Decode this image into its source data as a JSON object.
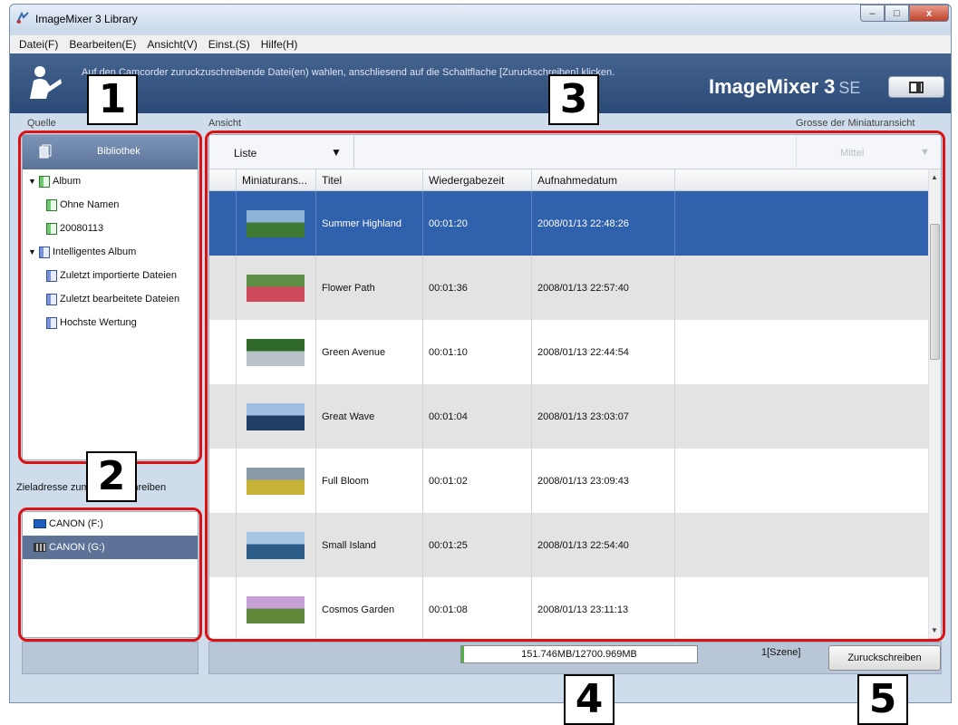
{
  "window": {
    "title": "ImageMixer 3 Library",
    "controls": [
      "–",
      "□",
      "x"
    ]
  },
  "menu": [
    "Datei(F)",
    "Bearbeiten(E)",
    "Ansicht(V)",
    "Einst.(S)",
    "Hilfe(H)"
  ],
  "banner": {
    "instruction": "Auf den Camcorder zuruckzuschreibende Datei(en) wahlen, anschliesend auf die Schaltflache [Zuruckschreiben] klicken.",
    "logo": "ImageMixer 3",
    "logo_suffix": "SE"
  },
  "labels": {
    "quelle": "Quelle",
    "ansicht": "Ansicht",
    "groesse": "Grosse der Miniaturansicht",
    "zieladresse": "Zieladresse zum Zuruckschreiben"
  },
  "library": {
    "header": "Bibliothek",
    "tree": [
      {
        "label": "Album",
        "level": 0,
        "expanded": true,
        "icon": "album-icon"
      },
      {
        "label": "Ohne Namen",
        "level": 1,
        "icon": "album-icon"
      },
      {
        "label": "20080113",
        "level": 1,
        "icon": "album-icon"
      },
      {
        "label": "Intelligentes Album",
        "level": 0,
        "expanded": true,
        "icon": "smart-album-icon"
      },
      {
        "label": "Zuletzt importierte Dateien",
        "level": 1,
        "icon": "smart-album-icon"
      },
      {
        "label": "Zuletzt bearbeitete Dateien",
        "level": 1,
        "icon": "smart-album-icon"
      },
      {
        "label": "Hochste Wertung",
        "level": 1,
        "icon": "smart-album-icon"
      }
    ]
  },
  "destinations": [
    {
      "label": "CANON (F:)",
      "icon": "sd-card-icon",
      "selected": false
    },
    {
      "label": "CANON (G:)",
      "icon": "tape-icon",
      "selected": true
    }
  ],
  "toolbar": {
    "view_mode": "Liste",
    "thumb_size": "Mittel"
  },
  "columns": [
    "Miniaturans...",
    "Titel",
    "Wiedergabezeit",
    "Aufnahmedatum"
  ],
  "rows": [
    {
      "title": "Summer Highland",
      "duration": "00:01:20",
      "date": "2008/01/13 22:48:26",
      "selected": true,
      "thumb": [
        "#8fb4d8",
        "#3f7a34"
      ]
    },
    {
      "title": "Flower Path",
      "duration": "00:01:36",
      "date": "2008/01/13 22:57:40",
      "selected": false,
      "thumb": [
        "#5f8e46",
        "#d0485c"
      ]
    },
    {
      "title": "Green Avenue",
      "duration": "00:01:10",
      "date": "2008/01/13 22:44:54",
      "selected": false,
      "thumb": [
        "#2f6a2a",
        "#b8c2c8"
      ]
    },
    {
      "title": "Great Wave",
      "duration": "00:01:04",
      "date": "2008/01/13 23:03:07",
      "selected": false,
      "thumb": [
        "#9fc0e0",
        "#1e3e66"
      ]
    },
    {
      "title": "Full Bloom",
      "duration": "00:01:02",
      "date": "2008/01/13 23:09:43",
      "selected": false,
      "thumb": [
        "#8a9aa8",
        "#c8b238"
      ]
    },
    {
      "title": "Small Island",
      "duration": "00:01:25",
      "date": "2008/01/13 22:54:40",
      "selected": false,
      "thumb": [
        "#a6c6e6",
        "#2f5d8a"
      ]
    },
    {
      "title": "Cosmos Garden",
      "duration": "00:01:08",
      "date": "2008/01/13 23:11:13",
      "selected": false,
      "thumb": [
        "#c6a0d6",
        "#5f8a3c"
      ]
    }
  ],
  "status": {
    "capacity": "151.746MB/12700.969MB",
    "capacity_fraction": 0.012,
    "scene": "1[Szene]",
    "write_back_button": "Zuruckschreiben"
  },
  "callouts": [
    "1",
    "2",
    "3",
    "4",
    "5"
  ]
}
